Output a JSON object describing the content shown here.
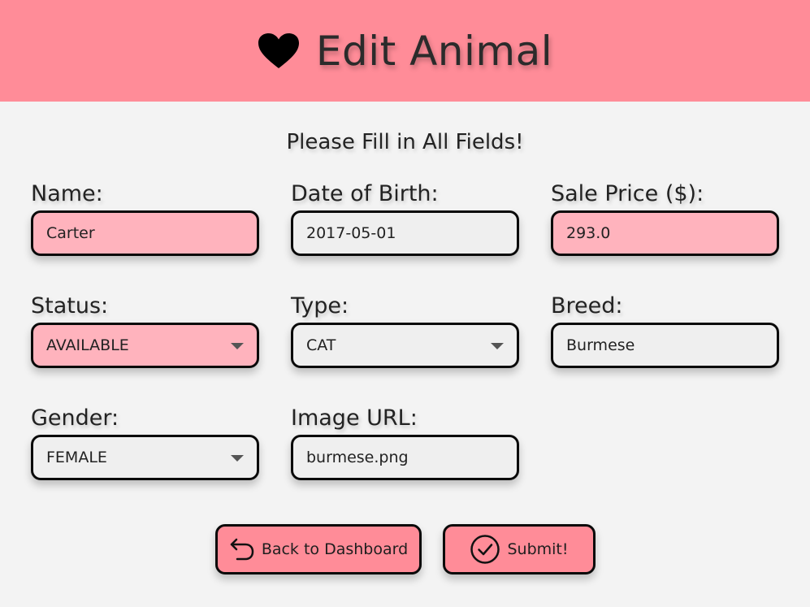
{
  "header": {
    "title": "Edit Animal",
    "icon": "heart-icon"
  },
  "form": {
    "instruction": "Please Fill in All Fields!",
    "name": {
      "label": "Name:",
      "value": "Carter"
    },
    "date_of_birth": {
      "label": "Date of Birth:",
      "value": "2017-05-01"
    },
    "sale_price": {
      "label": "Sale Price ($):",
      "value": "293.0"
    },
    "status": {
      "label": "Status:",
      "value": "AVAILABLE"
    },
    "type": {
      "label": "Type:",
      "value": "CAT"
    },
    "breed": {
      "label": "Breed:",
      "value": "Burmese"
    },
    "gender": {
      "label": "Gender:",
      "value": "FEMALE"
    },
    "image_url": {
      "label": "Image URL:",
      "value": "burmese.png"
    }
  },
  "actions": {
    "back_label": "Back to Dashboard",
    "back_icon": "undo-arrow-icon",
    "submit_label": "Submit!",
    "submit_icon": "check-circle-icon"
  },
  "colors": {
    "header_bg": "#ff8c98",
    "page_bg": "#f3f3f3",
    "highlight_field_bg": "#ffb3bd",
    "field_bg": "#efefef",
    "border": "#0a0a0a"
  }
}
